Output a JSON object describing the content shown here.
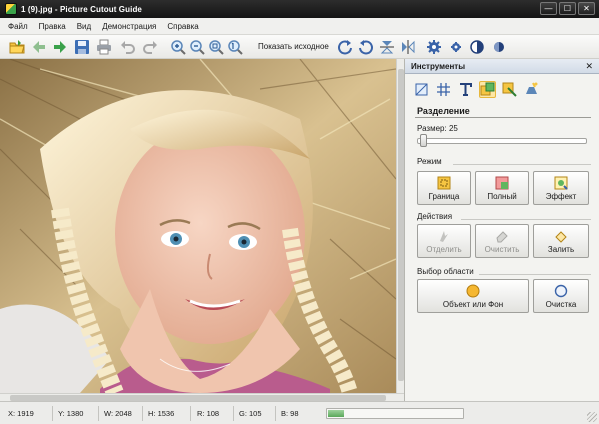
{
  "window": {
    "title": "1 (9).jpg - Picture Cutout Guide",
    "buttons": {
      "minimize": "—",
      "maximize": "☐",
      "close": "✕"
    }
  },
  "menu": [
    "Файл",
    "Правка",
    "Вид",
    "Демонстрация",
    "Справка"
  ],
  "toolbar": {
    "show_original_label": "Показать исходное",
    "icons": [
      "open-folder-icon",
      "back-arrow-icon",
      "forward-arrow-icon",
      "save-icon",
      "print-icon",
      "undo-icon",
      "redo-icon",
      "zoom-in-icon",
      "zoom-out-icon",
      "zoom-fit-icon",
      "zoom-actual-icon",
      "rotate-right-icon",
      "rotate-left-icon",
      "flip-vertical-icon",
      "flip-horizontal-icon",
      "settings-gear-icon",
      "small-gear-icon",
      "contrast-icon",
      "half-circle-icon"
    ]
  },
  "panel": {
    "title": "Инструменты",
    "close_glyph": "✕",
    "section_title": "Разделение",
    "size_label": "Размер: 25",
    "size_value": 25,
    "tools": [
      "crop-tool-icon",
      "grid-tool-icon",
      "text-tool-icon",
      "cutout-tool-icon",
      "cutout-alt-tool-icon",
      "magic-hat-tool-icon"
    ],
    "mode": {
      "label": "Режим",
      "buttons": [
        "Граница",
        "Полный",
        "Эффект"
      ]
    },
    "actions": {
      "label": "Действия",
      "buttons": [
        "Отделить",
        "Очистить",
        "Залить"
      ]
    },
    "selection": {
      "label": "Выбор области",
      "buttons": [
        "Объект или Фон",
        "Очистка"
      ]
    }
  },
  "status": {
    "x": "X: 1919",
    "y": "Y: 1380",
    "w": "W: 2048",
    "h": "H: 1536",
    "r": "R: 108",
    "g": "G: 105",
    "b": "B: 98"
  },
  "progress_fraction": 0.12,
  "colors": {
    "accent": "#e7b73c",
    "panel_header": "#d2dbe7",
    "titlebar": "#1a1a1a"
  }
}
